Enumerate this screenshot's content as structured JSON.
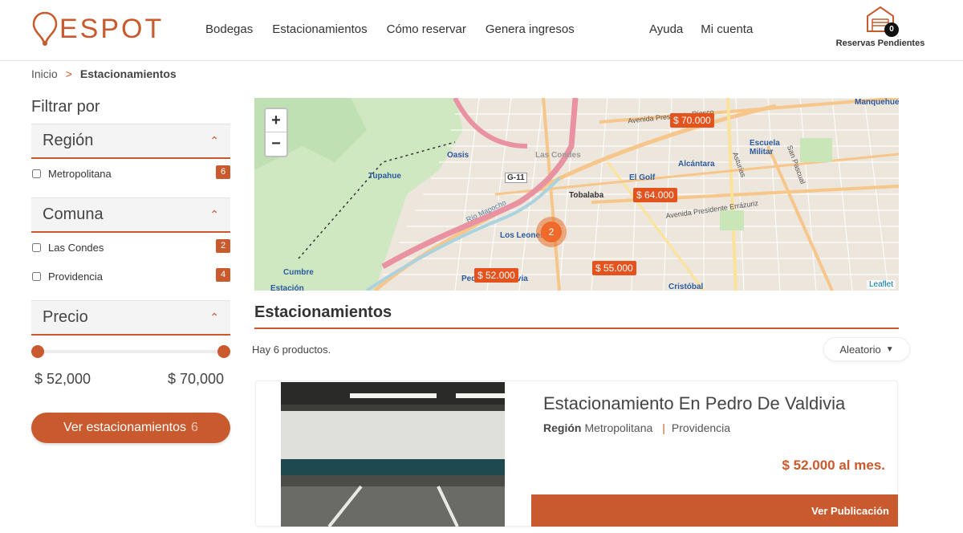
{
  "brand": {
    "name": "ESPOT",
    "accent": "#c95a2e"
  },
  "nav": [
    "Bodegas",
    "Estacionamientos",
    "Cómo reservar",
    "Genera ingresos"
  ],
  "nav_right": [
    "Ayuda",
    "Mi cuenta"
  ],
  "reservas": {
    "count": "0",
    "label": "Reservas Pendientes"
  },
  "breadcrumb": {
    "home": "Inicio",
    "sep": ">",
    "current": "Estacionamientos"
  },
  "sidebar": {
    "title": "Filtrar por",
    "region": {
      "title": "Región",
      "options": [
        {
          "label": "Metropolitana",
          "count": "6"
        }
      ]
    },
    "comuna": {
      "title": "Comuna",
      "options": [
        {
          "label": "Las Condes",
          "count": "2"
        },
        {
          "label": "Providencia",
          "count": "4"
        }
      ]
    },
    "precio": {
      "title": "Precio",
      "min": "$ 52,000",
      "max": "$ 70,000",
      "range_fraction": [
        0,
        1
      ]
    },
    "button": {
      "label": "Ver estacionamientos",
      "count": "6"
    }
  },
  "map": {
    "zoom_in": "+",
    "zoom_out": "−",
    "markers": [
      "$ 70.000",
      "$ 64.000",
      "$ 55.000",
      "$ 52.000"
    ],
    "cluster": "2",
    "labels": [
      "Oasis",
      "Tupahue",
      "Cumbre",
      "Estación",
      "Las Condes",
      "Tobalaba",
      "El Golf",
      "Alcántara",
      "Escuela Militar",
      "Los Leones",
      "Pedro de Valdivia",
      "Cristóbal",
      "G-11",
      "Manquehue"
    ],
    "streets": [
      "Avenida Presidente Riesco",
      "Avenida Presidente Errázuriz",
      "Río Mapocho",
      "Asturias",
      "San Pascual"
    ],
    "attribution": "Leaflet"
  },
  "listing": {
    "title": "Estacionamientos",
    "count_text": "Hay 6 productos.",
    "sort": "Aleatorio",
    "card": {
      "title": "Estacionamiento En Pedro De Valdivia",
      "region_label": "Región",
      "region": "Metropolitana",
      "comuna": "Providencia",
      "price": "$ 52.000 al mes.",
      "cta": "Ver Publicación"
    }
  }
}
